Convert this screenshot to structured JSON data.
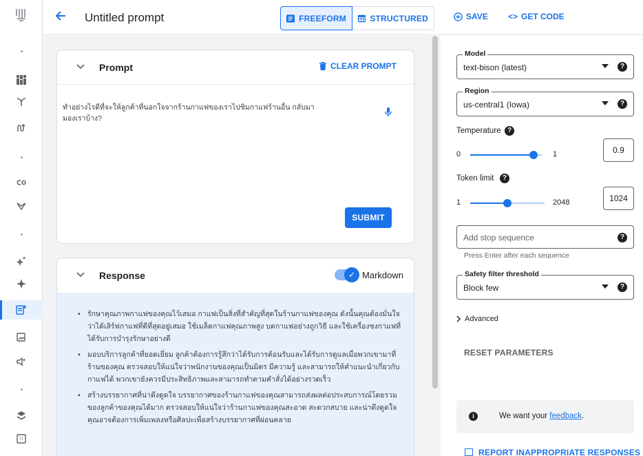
{
  "header": {
    "title": "Untitled prompt",
    "freeform_label": "FREEFORM",
    "structured_label": "STRUCTURED"
  },
  "rail": {
    "items": [
      "logo-icon",
      "dot",
      "dashboard-icon",
      "branch-icon",
      "routing-icon",
      "dot",
      "co-icon",
      "model-garden-icon",
      "dot",
      "sparkle-icon",
      "star-icon",
      "prompt-design-icon",
      "image-icon",
      "speech-icon",
      "dot",
      "layers-icon",
      "grid-icon"
    ]
  },
  "prompt": {
    "title": "Prompt",
    "clear_label": "CLEAR PROMPT",
    "text": "ทำอย่างไรดีที่จะให้ลูกค้าที่นอกใจจากร้านกาแฟของเราไปชิมกาแฟร้านอื่น กลับมามองเราบ้าง?",
    "submit_label": "SUBMIT"
  },
  "response": {
    "title": "Response",
    "markdown_label": "Markdown",
    "markdown_on": true,
    "bullets": [
      "รักษาคุณภาพกาแฟของคุณไว้เสมอ กาแฟเป็นสิ่งที่สำคัญที่สุดในร้านกาแฟของคุณ ดังนั้นคุณต้องมั่นใจว่าได้เสิร์ฟกาแฟที่ดีที่สุดอยู่เสมอ ใช้เมล็ดกาแฟคุณภาพสูง บดกาแฟอย่างถูกวิธี และใช้เครื่องชงกาแฟที่ได้รับการบำรุงรักษาอย่างดี",
      "มอบบริการลูกค้าที่ยอดเยี่ยม ลูกค้าต้องการรู้สึกว่าได้รับการต้อนรับและได้รับการดูแลเมื่อพวกเขามาที่ร้านของคุณ ตรวจสอบให้แน่ใจว่าพนักงานของคุณเป็นมิตร มีความรู้ และสามารถให้คำแนะนำเกี่ยวกับกาแฟได้ พวกเขายังควรมีประสิทธิภาพและสามารถทำตามคำสั่งได้อย่างรวดเร็ว",
      "สร้างบรรยากาศที่น่าดึงดูดใจ บรรยากาศของร้านกาแฟของคุณสามารถส่งผลต่อประสบการณ์โดยรวมของลูกค้าของคุณได้มาก ตรวจสอบให้แน่ใจว่าร้านกาแฟของคุณสะอาด สะดวกสบาย และน่าดึงดูดใจ คุณอาจต้องการเพิ่มเพลงหรือศิลปะเพื่อสร้างบรรยากาศที่ผ่อนคลาย"
    ]
  },
  "right": {
    "save_label": "SAVE",
    "get_code_label": "GET CODE",
    "model_label": "Model",
    "model_value": "text-bison (latest)",
    "region_label": "Region",
    "region_value": "us-central1 (Iowa)",
    "temperature_label": "Temperature",
    "temperature_min": "0",
    "temperature_max": "1",
    "temperature_value": "0.9",
    "token_label": "Token limit",
    "token_min": "1",
    "token_max": "2048",
    "token_value": "1024",
    "stop_placeholder": "Add stop sequence",
    "stop_hint": "Press Enter after each sequence",
    "safety_label": "Safety filter threshold",
    "safety_value": "Block few",
    "advanced_label": "Advanced",
    "reset_label": "RESET PARAMETERS",
    "feedback_prefix": "We want your ",
    "feedback_link": "feedback",
    "feedback_suffix": ".",
    "report_label": "REPORT INAPPROPRIATE RESPONSES"
  },
  "colors": {
    "accent": "#1a73e8",
    "selected_bg": "#e8f0fe",
    "main_bg": "#f1f3f4"
  }
}
